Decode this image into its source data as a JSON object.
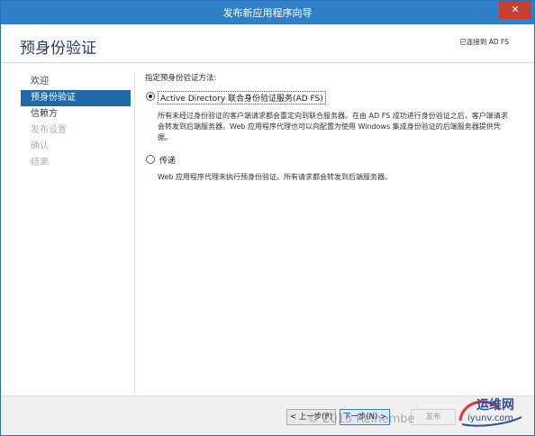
{
  "window": {
    "title": "发布新应用程序向导",
    "close_glyph": "✕"
  },
  "header": {
    "heading": "预身份验证",
    "destination": "已连接到 AD FS"
  },
  "nav": {
    "items": [
      {
        "label": "欢迎",
        "state": "normal"
      },
      {
        "label": "预身份验证",
        "state": "active"
      },
      {
        "label": "信赖方",
        "state": "normal"
      },
      {
        "label": "发布设置",
        "state": "disabled"
      },
      {
        "label": "确认",
        "state": "disabled"
      },
      {
        "label": "结果",
        "state": "disabled"
      }
    ]
  },
  "main": {
    "section_label": "指定预身份验证方法:",
    "options": [
      {
        "label": "Active Directory 联合身份验证服务(AD FS)",
        "checked": true,
        "description": "所有未经过身份验证的客户端请求都会重定向到联合服务器。在由 AD FS 成功进行身份验证之后，客户端请求会转发到后端服务器。Web 应用程序代理也可以向配置为使用 Windows 集成身份验证的后端服务器提供凭据。"
      },
      {
        "label": "传递",
        "checked": false,
        "description": "Web 应用程序代理未执行预身份验证。所有请求都会转发到后端服务器。"
      }
    ]
  },
  "footer": {
    "prev_label": "< 上一步(P)",
    "next_label": "下一步(N) >",
    "publish_label": "发布"
  },
  "watermark": {
    "text": "© 2015 Reinembe"
  },
  "logo": {
    "text": "运维网",
    "url": "iyunv.com"
  }
}
